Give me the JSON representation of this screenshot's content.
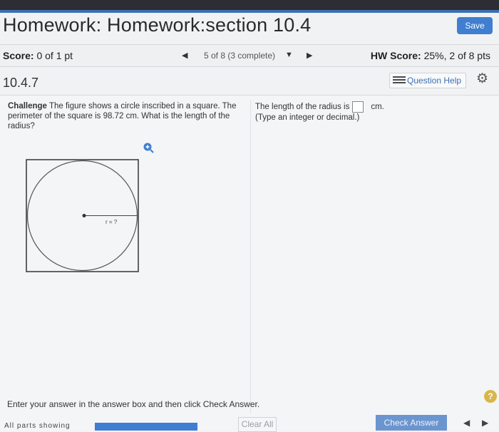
{
  "header": {
    "title": "Homework: Homework:section 10.4",
    "save_label": "Save"
  },
  "score_row": {
    "score_label": "Score:",
    "score_value": "0 of 1 pt",
    "nav_text": "5 of 8 (3 complete)",
    "hw_label": "HW Score:",
    "hw_value": "25%, 2 of 8 pts"
  },
  "question": {
    "number": "10.4.7",
    "help_label": "Question Help"
  },
  "problem": {
    "lead": "Challenge",
    "text": "The figure shows a circle inscribed in a square. The perimeter of the square is 98.72 cm. What is the length of the radius?",
    "figure_label": "r = ?"
  },
  "answer": {
    "prompt": "The length of the radius is",
    "unit": "cm.",
    "hint": "(Type an integer or decimal.)"
  },
  "footer": {
    "instruction": "Enter your answer in the answer box and then click Check Answer.",
    "partial_text": "All parts showing",
    "clear_label": "Clear All",
    "check_label": "Check Answer",
    "help_symbol": "?"
  },
  "colors": {
    "accent": "#3f7ed0",
    "link": "#3f6fb2",
    "help_badge": "#d9b64a"
  }
}
